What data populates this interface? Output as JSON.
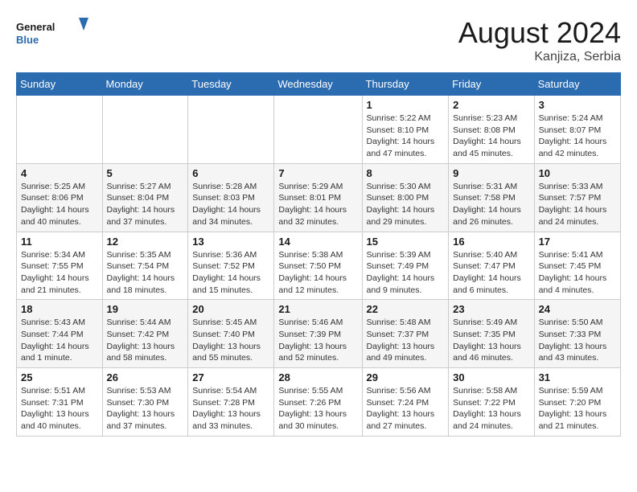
{
  "header": {
    "logo_text_general": "General",
    "logo_text_blue": "Blue",
    "month_year": "August 2024",
    "location": "Kanjiza, Serbia"
  },
  "weekdays": [
    "Sunday",
    "Monday",
    "Tuesday",
    "Wednesday",
    "Thursday",
    "Friday",
    "Saturday"
  ],
  "weeks": [
    [
      {
        "day": "",
        "info": ""
      },
      {
        "day": "",
        "info": ""
      },
      {
        "day": "",
        "info": ""
      },
      {
        "day": "",
        "info": ""
      },
      {
        "day": "1",
        "info": "Sunrise: 5:22 AM\nSunset: 8:10 PM\nDaylight: 14 hours\nand 47 minutes."
      },
      {
        "day": "2",
        "info": "Sunrise: 5:23 AM\nSunset: 8:08 PM\nDaylight: 14 hours\nand 45 minutes."
      },
      {
        "day": "3",
        "info": "Sunrise: 5:24 AM\nSunset: 8:07 PM\nDaylight: 14 hours\nand 42 minutes."
      }
    ],
    [
      {
        "day": "4",
        "info": "Sunrise: 5:25 AM\nSunset: 8:06 PM\nDaylight: 14 hours\nand 40 minutes."
      },
      {
        "day": "5",
        "info": "Sunrise: 5:27 AM\nSunset: 8:04 PM\nDaylight: 14 hours\nand 37 minutes."
      },
      {
        "day": "6",
        "info": "Sunrise: 5:28 AM\nSunset: 8:03 PM\nDaylight: 14 hours\nand 34 minutes."
      },
      {
        "day": "7",
        "info": "Sunrise: 5:29 AM\nSunset: 8:01 PM\nDaylight: 14 hours\nand 32 minutes."
      },
      {
        "day": "8",
        "info": "Sunrise: 5:30 AM\nSunset: 8:00 PM\nDaylight: 14 hours\nand 29 minutes."
      },
      {
        "day": "9",
        "info": "Sunrise: 5:31 AM\nSunset: 7:58 PM\nDaylight: 14 hours\nand 26 minutes."
      },
      {
        "day": "10",
        "info": "Sunrise: 5:33 AM\nSunset: 7:57 PM\nDaylight: 14 hours\nand 24 minutes."
      }
    ],
    [
      {
        "day": "11",
        "info": "Sunrise: 5:34 AM\nSunset: 7:55 PM\nDaylight: 14 hours\nand 21 minutes."
      },
      {
        "day": "12",
        "info": "Sunrise: 5:35 AM\nSunset: 7:54 PM\nDaylight: 14 hours\nand 18 minutes."
      },
      {
        "day": "13",
        "info": "Sunrise: 5:36 AM\nSunset: 7:52 PM\nDaylight: 14 hours\nand 15 minutes."
      },
      {
        "day": "14",
        "info": "Sunrise: 5:38 AM\nSunset: 7:50 PM\nDaylight: 14 hours\nand 12 minutes."
      },
      {
        "day": "15",
        "info": "Sunrise: 5:39 AM\nSunset: 7:49 PM\nDaylight: 14 hours\nand 9 minutes."
      },
      {
        "day": "16",
        "info": "Sunrise: 5:40 AM\nSunset: 7:47 PM\nDaylight: 14 hours\nand 6 minutes."
      },
      {
        "day": "17",
        "info": "Sunrise: 5:41 AM\nSunset: 7:45 PM\nDaylight: 14 hours\nand 4 minutes."
      }
    ],
    [
      {
        "day": "18",
        "info": "Sunrise: 5:43 AM\nSunset: 7:44 PM\nDaylight: 14 hours\nand 1 minute."
      },
      {
        "day": "19",
        "info": "Sunrise: 5:44 AM\nSunset: 7:42 PM\nDaylight: 13 hours\nand 58 minutes."
      },
      {
        "day": "20",
        "info": "Sunrise: 5:45 AM\nSunset: 7:40 PM\nDaylight: 13 hours\nand 55 minutes."
      },
      {
        "day": "21",
        "info": "Sunrise: 5:46 AM\nSunset: 7:39 PM\nDaylight: 13 hours\nand 52 minutes."
      },
      {
        "day": "22",
        "info": "Sunrise: 5:48 AM\nSunset: 7:37 PM\nDaylight: 13 hours\nand 49 minutes."
      },
      {
        "day": "23",
        "info": "Sunrise: 5:49 AM\nSunset: 7:35 PM\nDaylight: 13 hours\nand 46 minutes."
      },
      {
        "day": "24",
        "info": "Sunrise: 5:50 AM\nSunset: 7:33 PM\nDaylight: 13 hours\nand 43 minutes."
      }
    ],
    [
      {
        "day": "25",
        "info": "Sunrise: 5:51 AM\nSunset: 7:31 PM\nDaylight: 13 hours\nand 40 minutes."
      },
      {
        "day": "26",
        "info": "Sunrise: 5:53 AM\nSunset: 7:30 PM\nDaylight: 13 hours\nand 37 minutes."
      },
      {
        "day": "27",
        "info": "Sunrise: 5:54 AM\nSunset: 7:28 PM\nDaylight: 13 hours\nand 33 minutes."
      },
      {
        "day": "28",
        "info": "Sunrise: 5:55 AM\nSunset: 7:26 PM\nDaylight: 13 hours\nand 30 minutes."
      },
      {
        "day": "29",
        "info": "Sunrise: 5:56 AM\nSunset: 7:24 PM\nDaylight: 13 hours\nand 27 minutes."
      },
      {
        "day": "30",
        "info": "Sunrise: 5:58 AM\nSunset: 7:22 PM\nDaylight: 13 hours\nand 24 minutes."
      },
      {
        "day": "31",
        "info": "Sunrise: 5:59 AM\nSunset: 7:20 PM\nDaylight: 13 hours\nand 21 minutes."
      }
    ]
  ]
}
